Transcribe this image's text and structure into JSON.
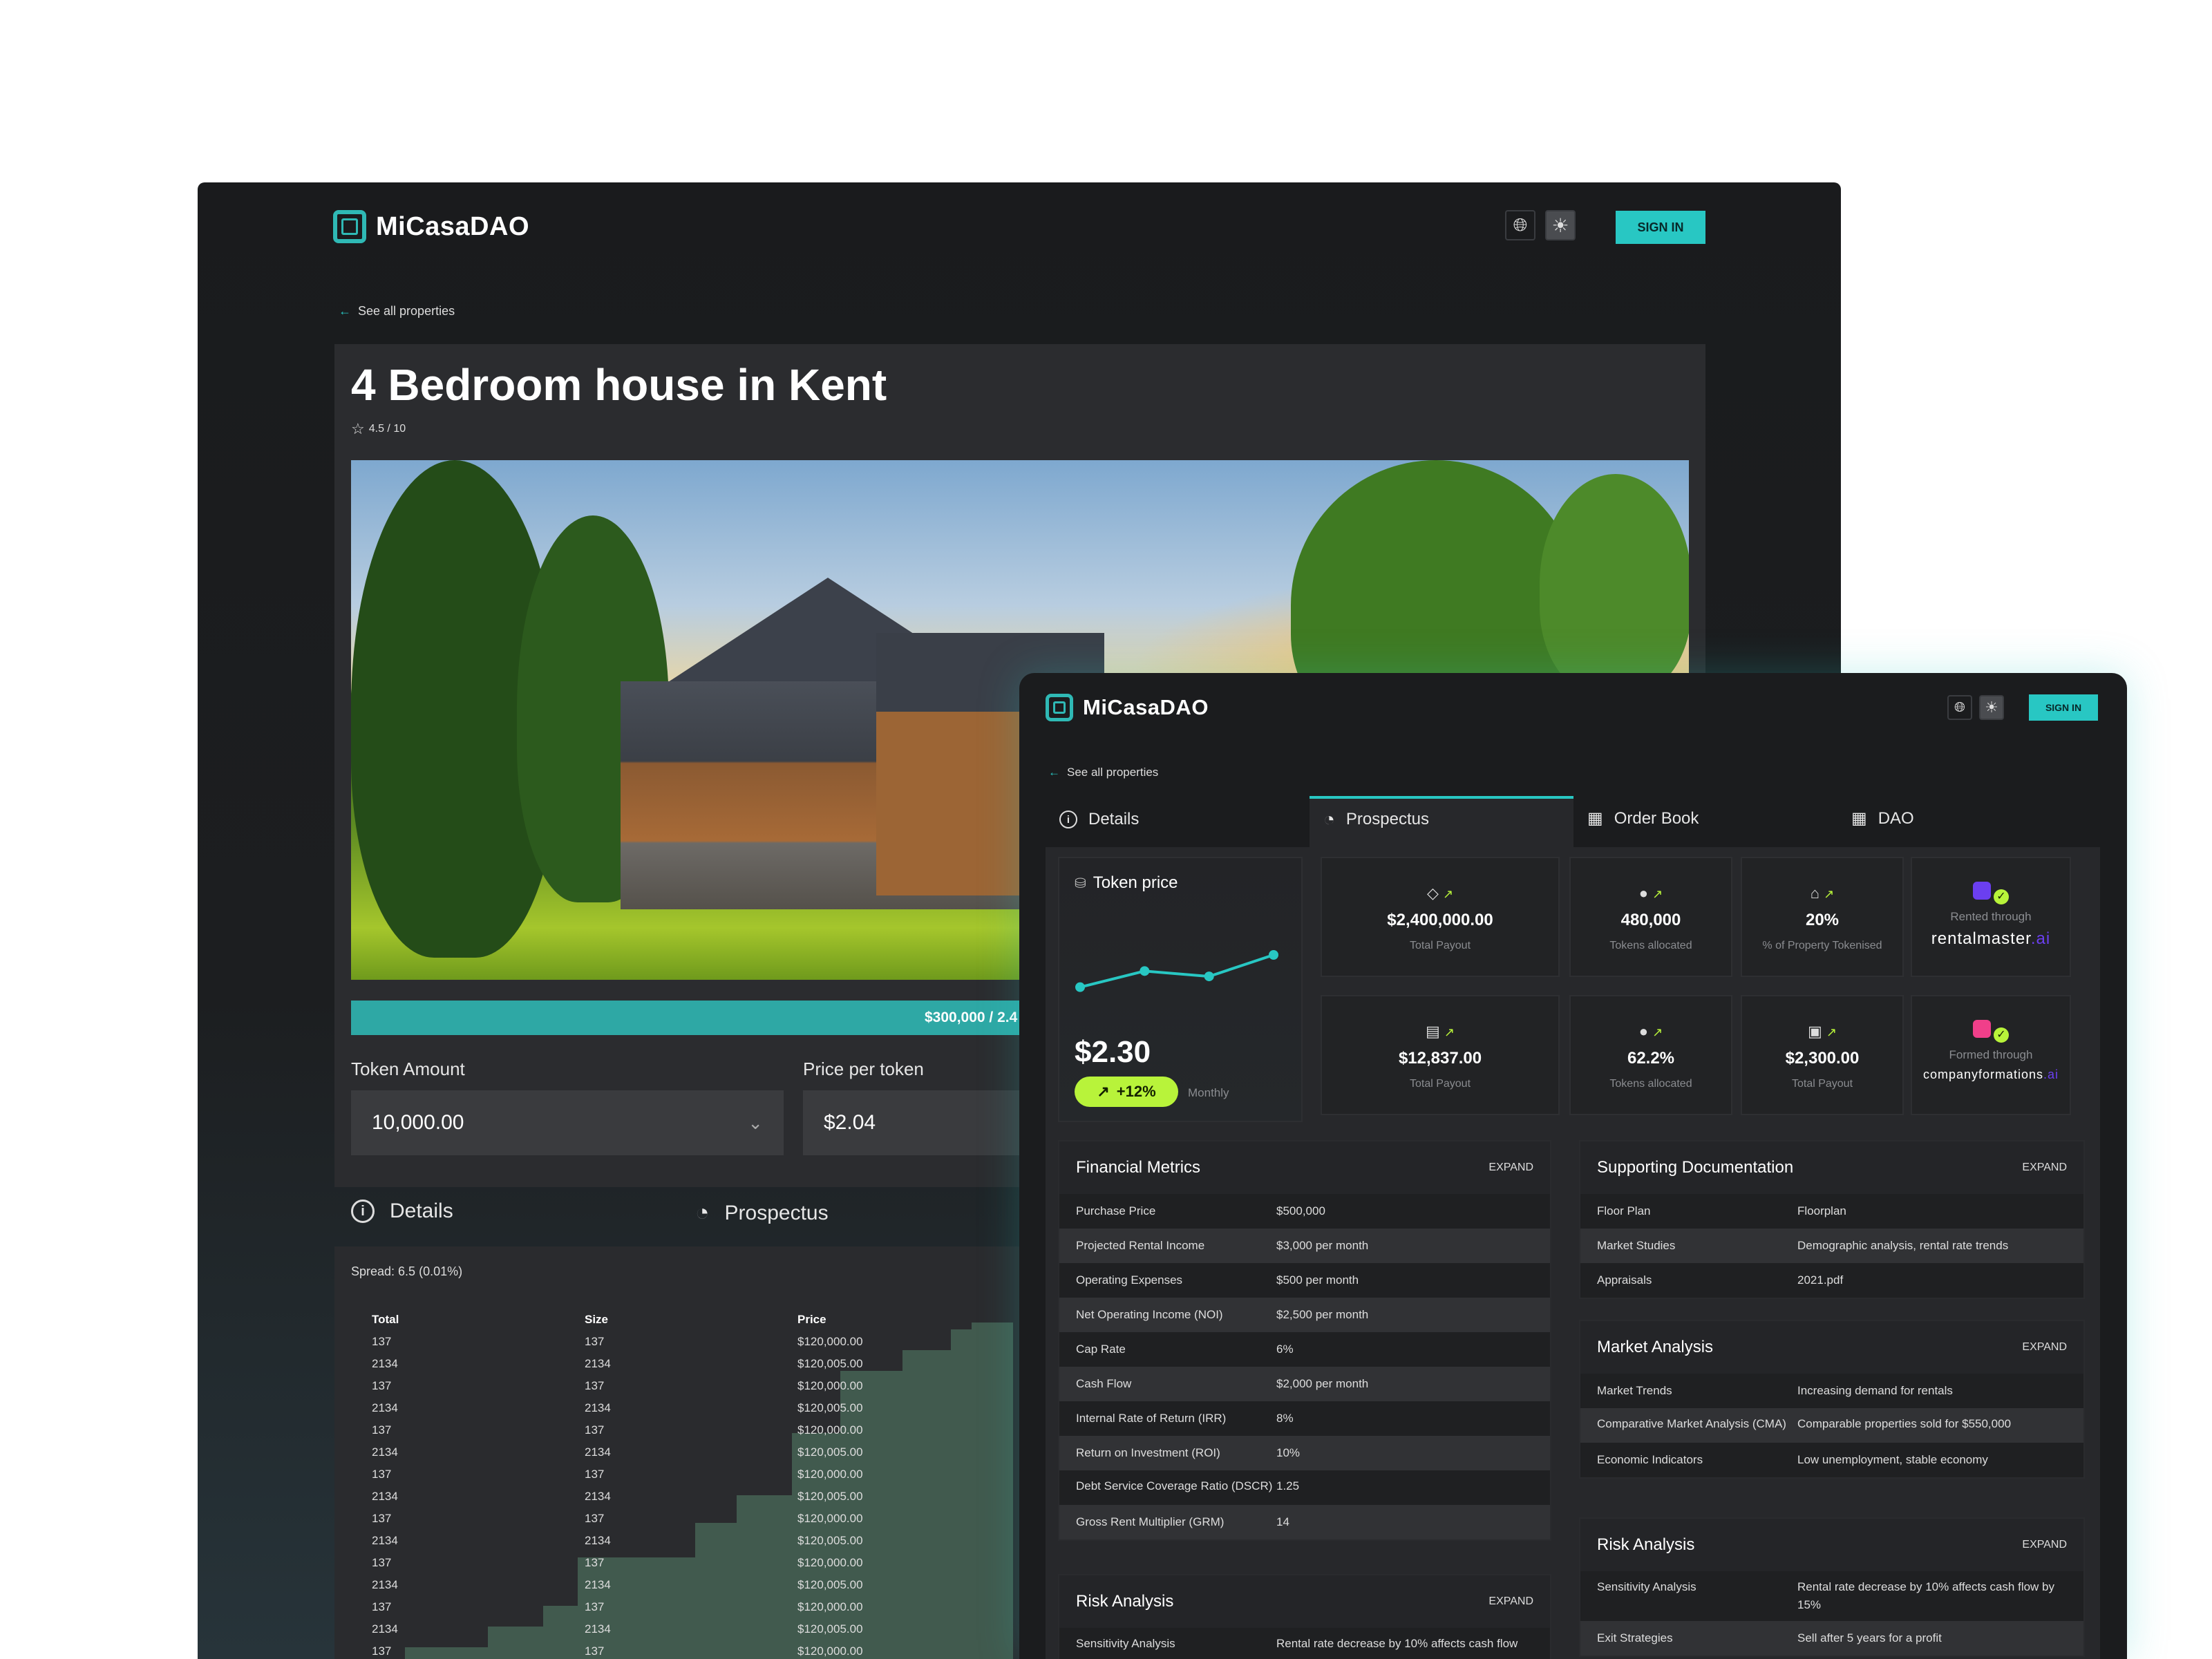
{
  "back_window": {
    "brand": "MiCasaDAO",
    "signin": "SIGN IN",
    "back_link": "See all properties",
    "title": "4 Bedroom house in Kent",
    "rating": "4.5 / 10",
    "progress_text": "$300,000 / 2.4",
    "token_amount_label": "Token Amount",
    "token_amount_value": "10,000.00",
    "price_label": "Price per token",
    "price_value": "$2.04",
    "tabs": [
      "Details",
      "Prospectus"
    ],
    "spread": "Spread: 6.5 (0.01%)",
    "order_book": {
      "columns": [
        "Total",
        "Size",
        "Price"
      ],
      "rows": [
        [
          "137",
          "137",
          "$120,000.00"
        ],
        [
          "2134",
          "2134",
          "$120,005.00"
        ],
        [
          "137",
          "137",
          "$120,000.00"
        ],
        [
          "2134",
          "2134",
          "$120,005.00"
        ],
        [
          "137",
          "137",
          "$120,000.00"
        ],
        [
          "2134",
          "2134",
          "$120,005.00"
        ],
        [
          "137",
          "137",
          "$120,000.00"
        ],
        [
          "2134",
          "2134",
          "$120,005.00"
        ],
        [
          "137",
          "137",
          "$120,000.00"
        ],
        [
          "2134",
          "2134",
          "$120,005.00"
        ],
        [
          "137",
          "137",
          "$120,000.00"
        ],
        [
          "2134",
          "2134",
          "$120,005.00"
        ],
        [
          "137",
          "137",
          "$120,000.00"
        ],
        [
          "2134",
          "2134",
          "$120,005.00"
        ],
        [
          "137",
          "137",
          "$120,000.00"
        ]
      ]
    }
  },
  "front_window": {
    "brand": "MiCasaDAO",
    "signin": "SIGN IN",
    "back_link": "See all properties",
    "tabs": [
      "Details",
      "Prospectus",
      "Order Book",
      "DAO"
    ],
    "token_price": {
      "label": "Token price",
      "value": "$2.30",
      "change": "+12%",
      "period": "Monthly",
      "sparkline": [
        3,
        6,
        5,
        9
      ]
    },
    "metrics_row1": [
      {
        "value": "$2,400,000.00",
        "label": "Total Payout",
        "icon": "tag-icon"
      },
      {
        "value": "480,000",
        "label": "Tokens allocated",
        "icon": "coins-icon"
      },
      {
        "value": "20%",
        "label": "% of Property Tokenised",
        "icon": "home-icon"
      },
      {
        "value": "rentalmaster",
        "suffix": ".ai",
        "label": "Rented through",
        "icon": "app-icon"
      }
    ],
    "metrics_row2": [
      {
        "value": "$12,837.00",
        "label": "Total Payout",
        "icon": "money-icon"
      },
      {
        "value": "62.2%",
        "label": "Tokens allocated",
        "icon": "coins-icon"
      },
      {
        "value": "$2,300.00",
        "label": "Total Payout",
        "icon": "cash-icon"
      },
      {
        "value": "companyformations",
        "suffix": ".ai",
        "label": "Formed through",
        "icon": "app-icon"
      }
    ],
    "financial_metrics": {
      "title": "Financial Metrics",
      "expand": "EXPAND",
      "rows": [
        [
          "Purchase Price",
          "$500,000"
        ],
        [
          "Projected Rental Income",
          "$3,000 per month"
        ],
        [
          "Operating Expenses",
          "$500 per month"
        ],
        [
          "Net Operating Income (NOI)",
          "$2,500 per month"
        ],
        [
          "Cap Rate",
          "6%"
        ],
        [
          "Cash Flow",
          "$2,000 per month"
        ],
        [
          "Internal Rate of Return (IRR)",
          "8%"
        ],
        [
          "Return on Investment (ROI)",
          "10%"
        ],
        [
          "Debt Service Coverage Ratio (DSCR)",
          "1.25"
        ],
        [
          "Gross Rent Multiplier (GRM)",
          "14"
        ]
      ]
    },
    "risk_analysis_left": {
      "title": "Risk Analysis",
      "expand": "EXPAND",
      "rows": [
        [
          "Sensitivity Analysis",
          "Rental rate decrease by 10% affects cash flow"
        ]
      ]
    },
    "supporting_docs": {
      "title": "Supporting Documentation",
      "expand": "EXPAND",
      "rows": [
        [
          "Floor Plan",
          "Floorplan"
        ],
        [
          "Market Studies",
          "Demographic analysis, rental rate trends"
        ],
        [
          "Appraisals",
          "2021.pdf"
        ]
      ]
    },
    "market_analysis": {
      "title": "Market Analysis",
      "expand": "EXPAND",
      "rows": [
        [
          "Market Trends",
          "Increasing demand for rentals"
        ],
        [
          "Comparative Market Analysis (CMA)",
          "Comparable properties sold for $550,000"
        ],
        [
          "Economic Indicators",
          "Low unemployment, stable economy"
        ]
      ]
    },
    "risk_analysis_right": {
      "title": "Risk Analysis",
      "expand": "EXPAND",
      "rows": [
        [
          "Sensitivity Analysis",
          "Rental rate decrease by 10% affects cash flow by 15%"
        ],
        [
          "Exit Strategies",
          "Sell after 5 years for a profit"
        ]
      ]
    }
  }
}
